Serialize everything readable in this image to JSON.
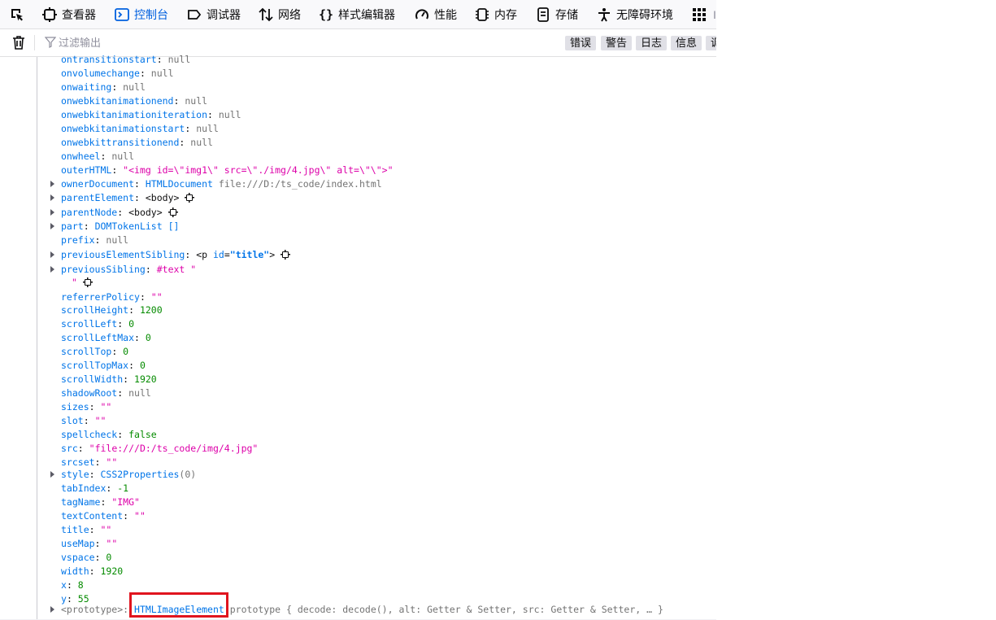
{
  "toolbar": {
    "tabs": [
      {
        "label": "查看器",
        "icon": "inspector-icon"
      },
      {
        "label": "控制台",
        "icon": "console-icon",
        "active": true
      },
      {
        "label": "调试器",
        "icon": "debugger-icon"
      },
      {
        "label": "网络",
        "icon": "network-icon"
      },
      {
        "label": "样式编辑器",
        "icon": "style-editor-icon"
      },
      {
        "label": "性能",
        "icon": "performance-icon"
      },
      {
        "label": "内存",
        "icon": "memory-icon"
      },
      {
        "label": "存储",
        "icon": "storage-icon"
      },
      {
        "label": "无障碍环境",
        "icon": "accessibility-icon"
      }
    ],
    "cut_label": "I"
  },
  "filter": {
    "placeholder": "过滤输出",
    "buttons": [
      "错误",
      "警告",
      "日志",
      "信息",
      "调"
    ]
  },
  "colors": {
    "accent": "#0060df",
    "key": "#0074e8",
    "string": "#dd00a9",
    "number": "#058b00",
    "null": "#737373",
    "highlight": "#e0141e"
  },
  "output": {
    "lines": [
      {
        "k": "ontransitionstart",
        "v": "null",
        "t": "nl"
      },
      {
        "k": "onvolumechange",
        "v": "null",
        "t": "nl"
      },
      {
        "k": "onwaiting",
        "v": "null",
        "t": "nl"
      },
      {
        "k": "onwebkitanimationend",
        "v": "null",
        "t": "nl"
      },
      {
        "k": "onwebkitanimationiteration",
        "v": "null",
        "t": "nl"
      },
      {
        "k": "onwebkitanimationstart",
        "v": "null",
        "t": "nl"
      },
      {
        "k": "onwebkittransitionend",
        "v": "null",
        "t": "nl"
      },
      {
        "k": "onwheel",
        "v": "null",
        "t": "nl"
      },
      {
        "k": "outerHTML",
        "v": "\"<img id=\\\"img1\\\" src=\\\"./img/4.jpg\\\" alt=\\\"\\\">\"",
        "t": "s"
      },
      {
        "k": "ownerDocument",
        "v": "HTMLDocument",
        "v2": " file:///D:/ts_code/index.html",
        "t": "obj",
        "tw": true
      },
      {
        "k": "parentElement",
        "v": "<body>",
        "t": "node",
        "tw": true,
        "inspect": true
      },
      {
        "k": "parentNode",
        "v": "<body>",
        "t": "node",
        "tw": true,
        "inspect": true
      },
      {
        "k": "part",
        "v": "DOMTokenList []",
        "t": "k",
        "tw": true
      },
      {
        "k": "prefix",
        "v": "null",
        "t": "nl"
      },
      {
        "k": "previousElementSibling",
        "t": "pnode",
        "tw": true,
        "inspect": true,
        "tag_open": "<p ",
        "attr": "id",
        "eq": "=",
        "attr_val": "\"title\"",
        "tag_close": ">"
      },
      {
        "k": "previousSibling",
        "v": "#text \"",
        "t": "s",
        "tw": true,
        "extra": "\""
      },
      {
        "k": "referrerPolicy",
        "v": "\"\"",
        "t": "s"
      },
      {
        "k": "scrollHeight",
        "v": "1200",
        "t": "n"
      },
      {
        "k": "scrollLeft",
        "v": "0",
        "t": "n"
      },
      {
        "k": "scrollLeftMax",
        "v": "0",
        "t": "n"
      },
      {
        "k": "scrollTop",
        "v": "0",
        "t": "n"
      },
      {
        "k": "scrollTopMax",
        "v": "0",
        "t": "n"
      },
      {
        "k": "scrollWidth",
        "v": "1920",
        "t": "n"
      },
      {
        "k": "shadowRoot",
        "v": "null",
        "t": "nl"
      },
      {
        "k": "sizes",
        "v": "\"\"",
        "t": "s"
      },
      {
        "k": "slot",
        "v": "\"\"",
        "t": "s"
      },
      {
        "k": "spellcheck",
        "v": "false",
        "t": "n"
      },
      {
        "k": "src",
        "v": "\"file:///D:/ts_code/img/4.jpg\"",
        "t": "s"
      },
      {
        "k": "srcset",
        "v": "\"\"",
        "t": "s"
      },
      {
        "k": "style",
        "v": "CSS2Properties",
        "v2": "(0)",
        "t": "obj2",
        "tw": true
      },
      {
        "k": "tabIndex",
        "v": "-1",
        "t": "n"
      },
      {
        "k": "tagName",
        "v": "\"IMG\"",
        "t": "s"
      },
      {
        "k": "textContent",
        "v": "\"\"",
        "t": "s"
      },
      {
        "k": "title",
        "v": "\"\"",
        "t": "s"
      },
      {
        "k": "useMap",
        "v": "\"\"",
        "t": "s"
      },
      {
        "k": "vspace",
        "v": "0",
        "t": "n"
      },
      {
        "k": "width",
        "v": "1920",
        "t": "n"
      },
      {
        "k": "x",
        "v": "8",
        "t": "n"
      },
      {
        "k": "y",
        "v": "55",
        "t": "n"
      }
    ],
    "prototype": {
      "key": "<prototype>",
      "class": "HTMLImageElement",
      "rest": "prototype { decode: decode(), alt: Getter & Setter, src: Getter & Setter, … }"
    }
  }
}
